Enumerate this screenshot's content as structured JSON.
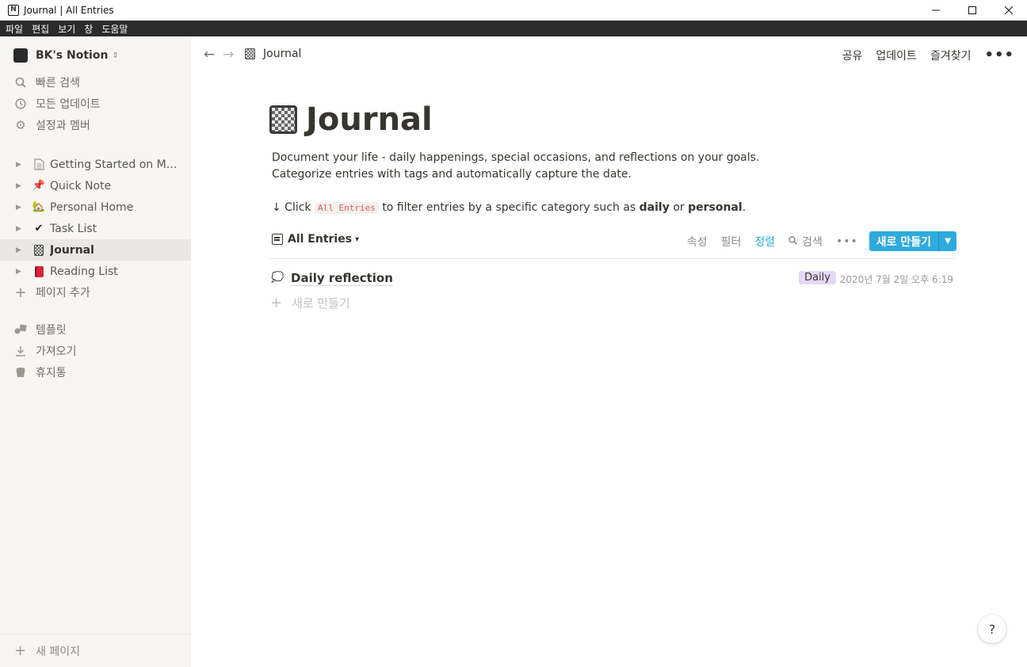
{
  "window": {
    "title": "Journal | All Entries"
  },
  "menubar": [
    "파일",
    "편집",
    "보기",
    "창",
    "도움말"
  ],
  "sidebar": {
    "workspace": "BK's Notion",
    "nav": [
      {
        "label": "빠른 검색",
        "icon": "search-icon"
      },
      {
        "label": "모든 업데이트",
        "icon": "clock-icon"
      },
      {
        "label": "설정과 멤버",
        "icon": "gear-icon"
      }
    ],
    "pages": [
      {
        "label": "Getting Started on Mob...",
        "icon": "page-icon"
      },
      {
        "label": "Quick Note",
        "icon": "pushpin-icon"
      },
      {
        "label": "Personal Home",
        "icon": "house-icon"
      },
      {
        "label": "Task List",
        "icon": "checkmark-icon"
      },
      {
        "label": "Journal",
        "icon": "notebook-icon",
        "active": true
      },
      {
        "label": "Reading List",
        "icon": "book-icon"
      }
    ],
    "add_page": "페이지 추가",
    "extras": [
      {
        "label": "템플릿",
        "icon": "shapes-icon"
      },
      {
        "label": "가져오기",
        "icon": "download-icon"
      },
      {
        "label": "휴지통",
        "icon": "trash-icon"
      }
    ],
    "new_page": "새 페이지"
  },
  "topbar": {
    "breadcrumb": "Journal",
    "actions": {
      "share": "공유",
      "updates": "업데이트",
      "favorite": "즐겨찾기"
    }
  },
  "page": {
    "title": "Journal",
    "description_line1": "Document your life - daily happenings, special occasions, and reflections on your goals.",
    "description_line2": "Categorize entries with tags and automatically capture the date.",
    "hint_prefix": "↓ Click",
    "hint_code": "All Entries",
    "hint_middle": "to filter entries by a specific category such as",
    "hint_daily": "daily",
    "hint_or": "or",
    "hint_personal": "personal",
    "hint_end": "."
  },
  "database": {
    "view": "All Entries",
    "tools": {
      "properties": "속성",
      "filter": "필터",
      "sort": "정렬",
      "search": "검색"
    },
    "new_button": "새로 만들기",
    "rows": [
      {
        "title": "Daily reflection",
        "tag": "Daily",
        "tag_color": "#e4d9f5",
        "date": "2020년 7월 2일 오후 6:19"
      }
    ],
    "new_row": "새로 만들기"
  },
  "help": "?",
  "colors": {
    "accent": "#2eaadc",
    "sidebar_bg": "#f7f6f3",
    "text": "#37352f"
  }
}
